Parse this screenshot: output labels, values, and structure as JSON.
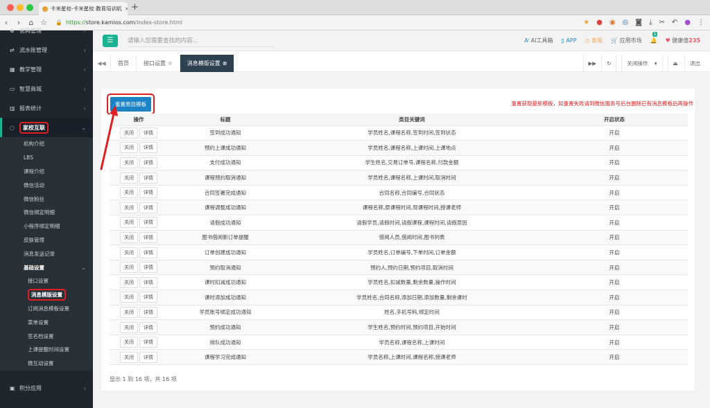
{
  "browser": {
    "tab_title": "卡米星校-卡米星校 教育培训机",
    "url_scheme": "https://",
    "url_host": "store.kamios.com",
    "url_path": "/index-store.html"
  },
  "sidebar": {
    "items_top": [
      {
        "label": "官网管理",
        "icon": "globe-icon"
      },
      {
        "label": "流水账管理",
        "icon": "exchange-icon"
      },
      {
        "label": "教学管理",
        "icon": "calendar-icon"
      },
      {
        "label": "智慧商城",
        "icon": "shop-icon"
      },
      {
        "label": "报表统计",
        "icon": "chart-icon"
      }
    ],
    "active_item": {
      "label": "家校互联",
      "icon": "chat-icon"
    },
    "sub_items": [
      "机构介绍",
      "LBS",
      "课程介绍",
      "微信活动",
      "微信粉丝",
      "微信绑定明细",
      "小程序绑定明细",
      "皮肤管理",
      "消息发送记录"
    ],
    "group": {
      "label": "基础设置",
      "items": [
        "接口设置",
        "消息模版设置",
        "订阅消息模板设置",
        "菜单设置",
        "签名档设置",
        "上课提醒时间设置",
        "微互动设置"
      ],
      "current_index": 1
    },
    "items_bottom": [
      {
        "label": "积分应用",
        "icon": "grid-icon"
      }
    ]
  },
  "topbar": {
    "search_placeholder": "请输入您需要查找的内容...",
    "ai": "AI工具箱",
    "app": "APP",
    "service": "客服",
    "market": "应用市场",
    "notif_count": "1",
    "health_label": "健康值",
    "health_value": "235"
  },
  "tabs": {
    "home": "首页",
    "items": [
      "接口设置",
      "消息模版设置"
    ],
    "close_ops": "关闭操作",
    "logout": "退出"
  },
  "main": {
    "reset_button": "重置类目模板",
    "notice": "重置获取最新模板，如重置失败请到微信服务号后台删除已有消息模板后再操作",
    "columns": [
      "操作",
      "标题",
      "类目关键词",
      "开启状态"
    ],
    "btn_close": "关闭",
    "btn_detail": "详情",
    "rows": [
      {
        "title": "签到成功通知",
        "keywords": "学员姓名,课程名称,签到时间,签到状态",
        "status": "开启"
      },
      {
        "title": "预约上课成功通知",
        "keywords": "学员姓名,课程名称,上课时间,上课地点",
        "status": "开启"
      },
      {
        "title": "支付成功通知",
        "keywords": "学生姓名,交易订单号,课程名称,付款金额",
        "status": "开启"
      },
      {
        "title": "课程预约取消通知",
        "keywords": "学员姓名,课程名称,上课时间,取消时间",
        "status": "开启"
      },
      {
        "title": "合同签署完成通知",
        "keywords": "合同名称,合同编号,合同状态",
        "status": "开启"
      },
      {
        "title": "课程调整成功通知",
        "keywords": "课程名称,原课程时间,现课程时间,授课老师",
        "status": "开启"
      },
      {
        "title": "请假成功通知",
        "keywords": "请假学员,请假时间,请假课程,课程时间,请假原因",
        "status": "开启"
      },
      {
        "title": "图书借阅新订单提醒",
        "keywords": "借阅人员,借阅时间,图书列表",
        "status": "开启"
      },
      {
        "title": "订单创建成功通知",
        "keywords": "学员姓名,订单编号,下单时间,订单金额",
        "status": "开启"
      },
      {
        "title": "预约取消通知",
        "keywords": "预约人,预约日期,预约项目,取消时间",
        "status": "开启"
      },
      {
        "title": "课时扣减成功通知",
        "keywords": "学员姓名,扣减数量,剩余数量,操作时间",
        "status": "开启"
      },
      {
        "title": "课时添加成功通知",
        "keywords": "学员姓名,合同名称,添加日期,添加数量,剩余课时",
        "status": "开启"
      },
      {
        "title": "学员账号绑定成功通知",
        "keywords": "姓名,手机号码,绑定时间",
        "status": "开启"
      },
      {
        "title": "预约成功通知",
        "keywords": "学生姓名,预约时间,预约项目,开始时间",
        "status": "开启"
      },
      {
        "title": "排队成功通知",
        "keywords": "学员名称,课程名称,上课时间",
        "status": "开启"
      },
      {
        "title": "课程学习完成通知",
        "keywords": "学员名称,上课时间,课程名称,授课老师",
        "status": "开启"
      }
    ],
    "footer": "显示 1 到 16 项，共 16 项"
  },
  "colors": {
    "accent": "#1ab394",
    "sidebar_bg": "#1f262d",
    "highlight": "#e02020",
    "primary": "#1c84c6"
  }
}
